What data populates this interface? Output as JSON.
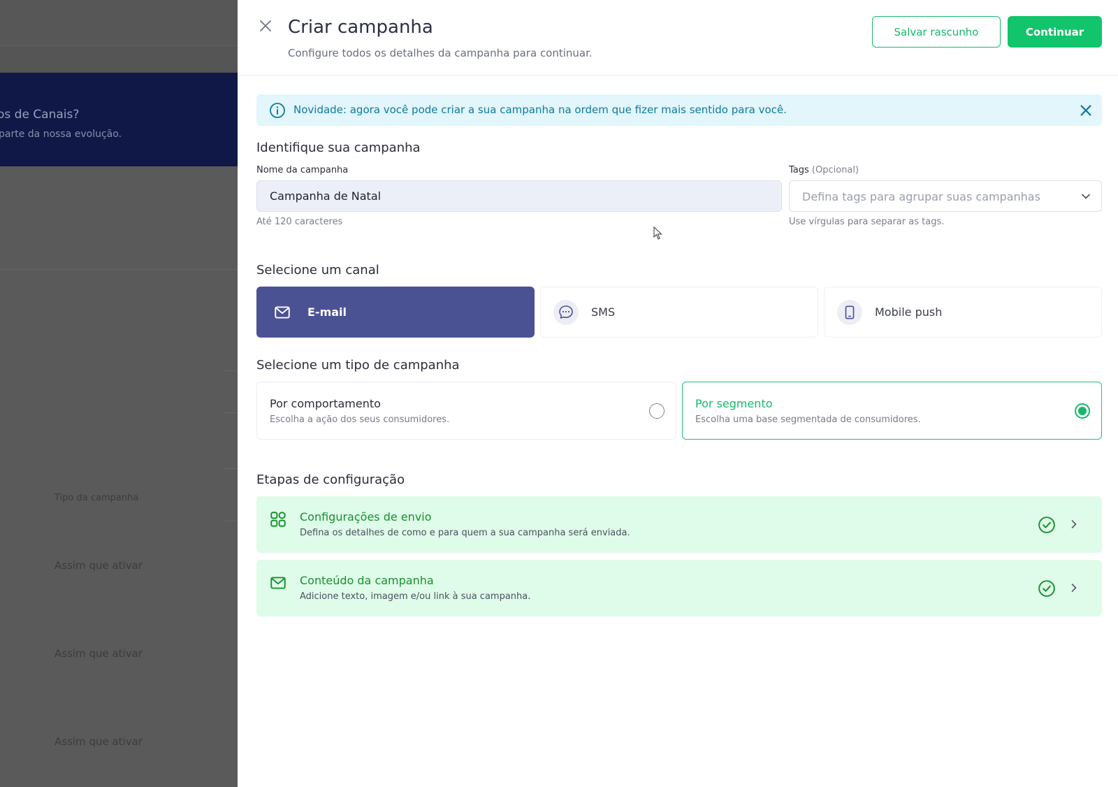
{
  "background": {
    "banner_title": "os de Canais?",
    "banner_subtitle": "parte da nossa evolução.",
    "rows": [
      {
        "label": "Tipo da campanha"
      },
      {
        "label": "Assim que ativar"
      },
      {
        "label": "Assim que ativar"
      },
      {
        "label": "Assim que ativar"
      }
    ]
  },
  "header": {
    "close_icon": "close-icon",
    "title": "Criar campanha",
    "subtitle": "Configure todos os detalhes da campanha para continuar.",
    "save_draft_label": "Salvar rascunho",
    "continue_label": "Continuar"
  },
  "notice": {
    "icon": "info-icon",
    "text": "Novidade: agora você pode criar a sua campanha na ordem que fizer mais sentido para você."
  },
  "identify": {
    "section_title": "Identifique sua campanha",
    "name_label": "Nome da campanha",
    "name_value": "Campanha de Natal",
    "name_hint": "Até 120 caracteres",
    "tags_label": "Tags",
    "tags_optional": "(Opcional)",
    "tags_placeholder": "Defina tags para agrupar suas campanhas",
    "tags_hint": "Use vírgulas para separar as tags."
  },
  "channel": {
    "section_title": "Selecione um canal",
    "options": [
      {
        "label": "E-mail",
        "icon": "mail-icon",
        "selected": true
      },
      {
        "label": "SMS",
        "icon": "chat-icon",
        "selected": false
      },
      {
        "label": "Mobile push",
        "icon": "smartphone-icon",
        "selected": false
      }
    ]
  },
  "campaign_type": {
    "section_title": "Selecione um tipo de campanha",
    "options": [
      {
        "title": "Por comportamento",
        "description": "Escolha a ação dos seus consumidores.",
        "selected": false
      },
      {
        "title": "Por segmento",
        "description": "Escolha uma base segmentada de consumidores.",
        "selected": true
      }
    ]
  },
  "steps": {
    "section_title": "Etapas de configuração",
    "items": [
      {
        "title": "Configurações de envio",
        "description": "Defina os detalhes de como e para quem a sua campanha será enviada.",
        "icon": "grid-icon",
        "status": "complete"
      },
      {
        "title": "Conteúdo da campanha",
        "description": "Adicione texto, imagem e/ou link à sua campanha.",
        "icon": "mail-icon",
        "status": "complete"
      }
    ]
  },
  "colors": {
    "primary_green": "#12c46c",
    "channel_selected": "#4b5294",
    "notice_bg": "#e2f6fb",
    "step_bg": "#dffbe9"
  }
}
